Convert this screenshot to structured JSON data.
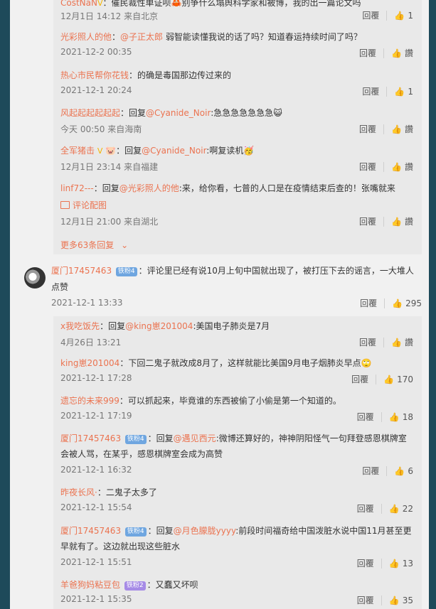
{
  "replies_top": [
    {
      "user": "CostNaN",
      "v": "V",
      "text": "：催民裁性单证呗🦀别争什么塌舆科学家和被博，我的出一篇论文吗",
      "meta": "12月1日 14:12 来自北京",
      "reply_label": "回覆",
      "likes": "1"
    },
    {
      "user": "光彩照人的他",
      "text_pre": "：",
      "at": "@子正太郎",
      "text": " 弱智能读懂我说的话了吗？知道春运持续时间了吗？",
      "meta": "2021-12-2 00:35",
      "reply_label": "回覆",
      "likes": "讚"
    },
    {
      "user": "热心市民帮你花钱",
      "text": "：的确是毒国那边传过来的",
      "meta": "2021-12-1 20:24",
      "reply_label": "回覆",
      "likes": "1"
    },
    {
      "user": "风起起起起起起",
      "text_pre": "：回复",
      "at": "@Cyanide_Noir",
      "text": ":急急急急急急急😺",
      "meta": "今天 00:50 来自海南",
      "reply_label": "回覆",
      "likes": "讚"
    },
    {
      "user": "全军猪击",
      "v": "V",
      "text_pre": " 🐷：回复",
      "at": "@Cyanide_Noir",
      "text": ":啊复读机🥳",
      "meta": "12月1日 23:14 来自福建",
      "reply_label": "回覆",
      "likes": "讚"
    },
    {
      "user": "linf72---",
      "text_pre": "：回复",
      "at": "@光彩照人的他",
      "text": ":来，给你看，七普的人口是在疫情结束后查的！张嘴就来",
      "sublink": "评论配图",
      "meta": "12月1日 21:00 来自湖北",
      "reply_label": "回覆",
      "likes": "讚"
    }
  ],
  "more_replies": "更多63条回复",
  "main_comment": {
    "user": "厦门17457463",
    "badge": "铁粉4",
    "text": "：评论里已经有说10月上旬中国就出现了，被打压下去的谣言，一大堆人点赞",
    "meta": "2021-12-1 13:33",
    "reply_label": "回覆",
    "likes": "295"
  },
  "replies_bottom": [
    {
      "user": "x我吃饭先",
      "text_pre": "：回复",
      "at": "@king崽201004",
      "text": ":美国电子肺炎是7月",
      "meta": "4月26日 13:21",
      "reply_label": "回覆",
      "likes": "讚"
    },
    {
      "user": "king崽201004",
      "text": "：下回二鬼子就改成8月了，这样就能比美国9月电子烟肺炎早点🙄",
      "meta": "2021-12-1 17:28",
      "reply_label": "回覆",
      "likes": "170"
    },
    {
      "user": "遗忘的未来999",
      "text": "：可以抓起来，毕竟谁的东西被偷了小偷是第一个知道的。",
      "meta": "2021-12-1 17:19",
      "reply_label": "回覆",
      "likes": "18"
    },
    {
      "user": "厦门17457463",
      "badge": "铁粉4",
      "text_pre": "：回复",
      "at": "@遇见西元",
      "text": ":微博还算好的，神神阴阳怪气一句拜登感恩棋牌室会被人骂，在某乎，感恩棋牌室会成为高赞",
      "meta": "2021-12-1 16:32",
      "reply_label": "回覆",
      "likes": "6"
    },
    {
      "user": "昨夜长风·",
      "text": "：二鬼子太多了",
      "meta": "2021-12-1 15:54",
      "reply_label": "回覆",
      "likes": "22"
    },
    {
      "user": "厦门17457463",
      "badge": "铁粉4",
      "text_pre": "：回复",
      "at": "@月色朦胧yyyy",
      "text": ":前段时间福奇给中国泼脏水说中国11月甚至更早就有了。这边就出现这些脏水",
      "meta": "2021-12-1 15:51",
      "reply_label": "回覆",
      "likes": "13"
    },
    {
      "user": "羊爸狗妈粘豆包",
      "badge2": "铁粉2",
      "text": "：又蠢又坏呗",
      "meta": "2021-12-1 15:35",
      "reply_label": "回覆",
      "likes": "35"
    }
  ]
}
